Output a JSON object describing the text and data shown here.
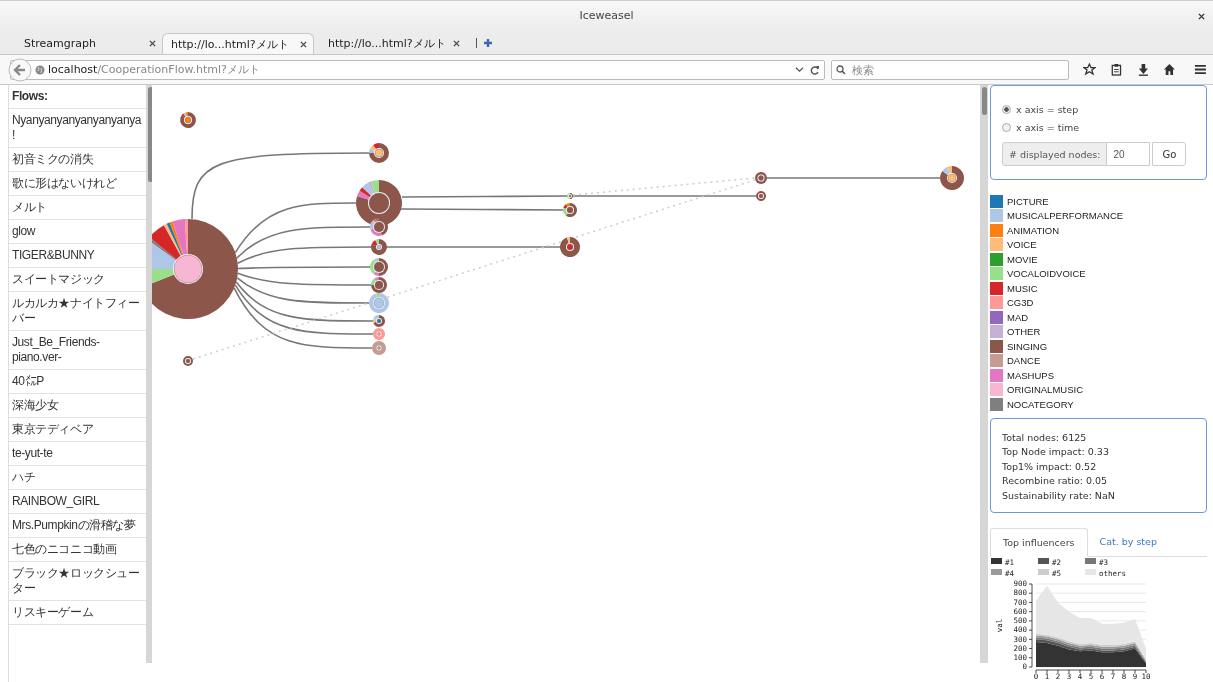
{
  "window": {
    "title": "Iceweasel"
  },
  "tabs": [
    {
      "label": "Streamgraph",
      "selected": false
    },
    {
      "label": "http://lo...html?メルト",
      "selected": true
    },
    {
      "label": "http://lo...html?メルト",
      "selected": false
    }
  ],
  "toolbar": {
    "url": "**localhost**/CooperationFlow.html?メルト",
    "search_placeholder": "検索"
  },
  "sidebar": {
    "heading": "Flows:",
    "items": [
      "Nyanyanyanyanyanyanya!",
      "初音ミクの消失",
      "歌に形はないけれど",
      "メルト",
      "glow",
      "TIGER&BUNNY",
      "スイートマジック",
      "ルカルカ★ナイトフィーバー",
      "Just_Be_Friends-piano.ver-",
      "40㍍P",
      "深海少女",
      "東京テディベア",
      "te-yut-te",
      "ハチ",
      "RAINBOW_GIRL",
      "Mrs.Pumpkinの滑稽な夢",
      "七色のニコニコ動画",
      "ブラック★ロックシューター",
      "リスキーゲーム"
    ]
  },
  "controls": {
    "radios": [
      {
        "label": "x axis = step",
        "selected": true
      },
      {
        "label": "x axis = time",
        "selected": false
      }
    ],
    "nodes_label": "# displayed nodes:",
    "nodes_value": "20",
    "go_button": "Go"
  },
  "legend": [
    {
      "label": "PICTURE",
      "color": "#1f77b4"
    },
    {
      "label": "MUSICALPERFORMANCE",
      "color": "#aec7e8"
    },
    {
      "label": "ANIMATION",
      "color": "#ff7f0e"
    },
    {
      "label": "VOICE",
      "color": "#ffbb78"
    },
    {
      "label": "MOVIE",
      "color": "#2ca02c"
    },
    {
      "label": "VOCALOIDVOICE",
      "color": "#98df8a"
    },
    {
      "label": "MUSIC",
      "color": "#d62728"
    },
    {
      "label": "CG3D",
      "color": "#ff9896"
    },
    {
      "label": "MAD",
      "color": "#9467bd"
    },
    {
      "label": "OTHER",
      "color": "#c5b0d5"
    },
    {
      "label": "SINGING",
      "color": "#8c564b"
    },
    {
      "label": "DANCE",
      "color": "#c49c94"
    },
    {
      "label": "MASHUPS",
      "color": "#e377c2"
    },
    {
      "label": "ORIGINALMUSIC",
      "color": "#f7b6d2"
    },
    {
      "label": "NOCATEGORY",
      "color": "#7f7f7f"
    }
  ],
  "stats": [
    "Total nodes: 6125",
    "Top Node impact: 0.33",
    "Top1% impact: 0.52",
    "Recombine ratio: 0.05",
    "Sustainability rate: NaN"
  ],
  "panel_tabs": [
    {
      "label": "Top influencers",
      "selected": true
    },
    {
      "label": "Cat. by step",
      "selected": false
    }
  ],
  "chart_data": {
    "type": "area",
    "stacked": true,
    "grid": true,
    "legend": "top",
    "ylabel": "val",
    "x": [
      0,
      1,
      2,
      3,
      4,
      5,
      6,
      7,
      8,
      9,
      10
    ],
    "xlim": [
      0,
      10
    ],
    "xticks": [
      0,
      1,
      2,
      3,
      4,
      5,
      6,
      7,
      8,
      9,
      10
    ],
    "yticks": [
      0,
      100,
      200,
      300,
      400,
      500,
      600,
      700,
      800,
      900
    ],
    "ylim": [
      0,
      900
    ],
    "series": [
      {
        "name": "#1",
        "color": "#333333",
        "values": [
          270,
          260,
          230,
          190,
          170,
          180,
          160,
          160,
          170,
          200,
          40
        ]
      },
      {
        "name": "#2",
        "color": "#555555",
        "values": [
          30,
          30,
          30,
          30,
          20,
          20,
          20,
          20,
          20,
          20,
          10
        ]
      },
      {
        "name": "#3",
        "color": "#777777",
        "values": [
          20,
          20,
          20,
          20,
          20,
          20,
          20,
          20,
          20,
          20,
          10
        ]
      },
      {
        "name": "#4",
        "color": "#999999",
        "values": [
          20,
          20,
          20,
          20,
          20,
          20,
          20,
          20,
          20,
          20,
          10
        ]
      },
      {
        "name": "#5",
        "color": "#cccccc",
        "values": [
          20,
          20,
          20,
          20,
          20,
          20,
          20,
          20,
          20,
          20,
          10
        ]
      },
      {
        "name": "others",
        "color": "#e6e6e6",
        "values": [
          360,
          530,
          380,
          320,
          280,
          270,
          230,
          230,
          230,
          240,
          120
        ]
      }
    ]
  }
}
